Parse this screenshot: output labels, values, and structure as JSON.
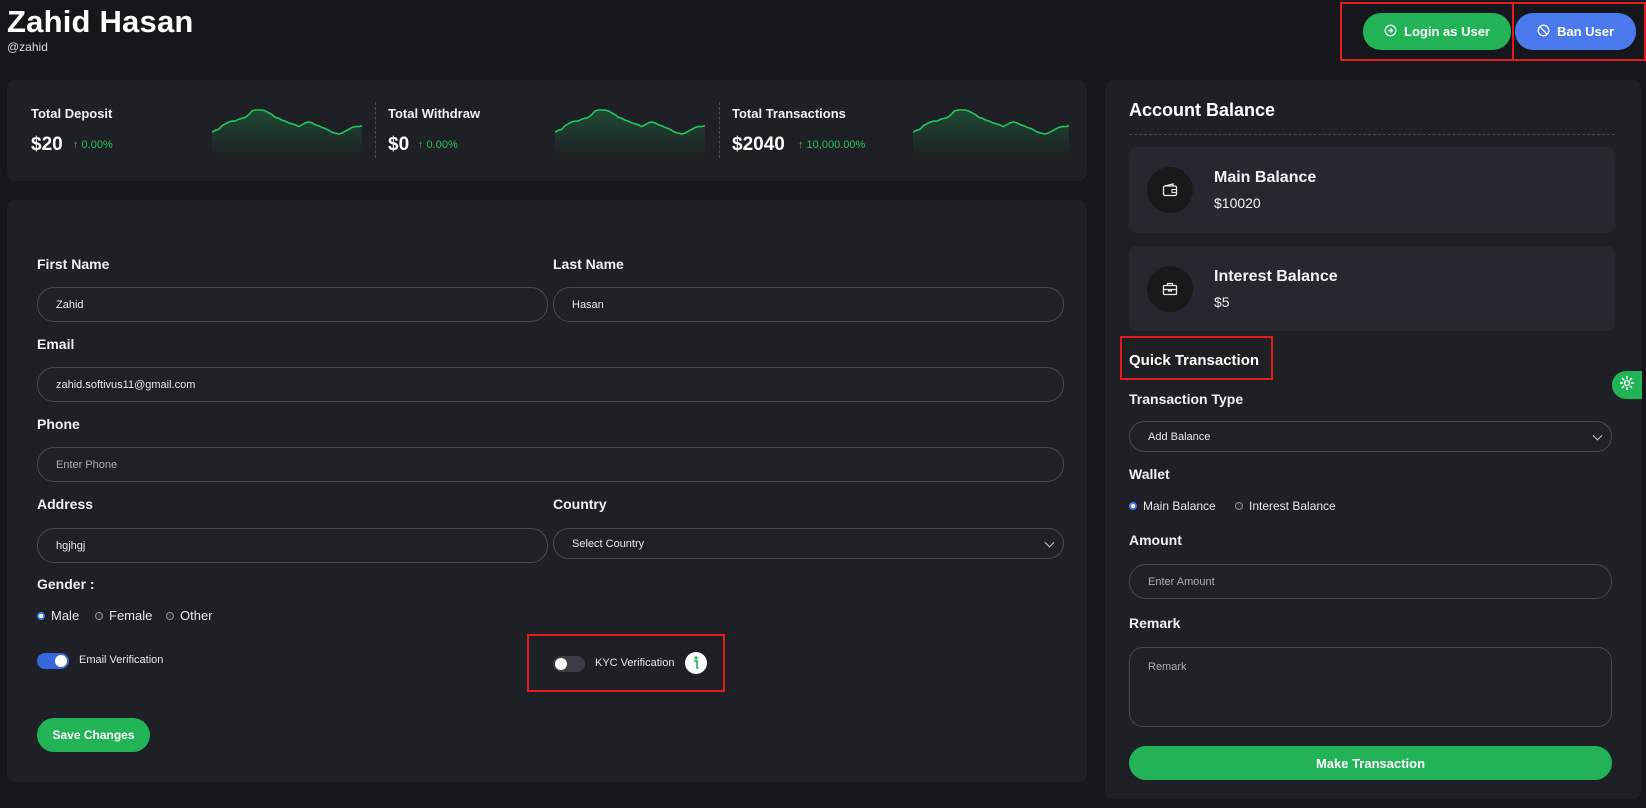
{
  "header": {
    "name": "Zahid Hasan",
    "username": "@zahid",
    "login_as_user": "Login as User",
    "ban_user": "Ban User"
  },
  "stats": [
    {
      "label": "Total Deposit",
      "value": "$20",
      "change": "↑ 0.00%"
    },
    {
      "label": "Total Withdraw",
      "value": "$0",
      "change": "↑ 0.00%"
    },
    {
      "label": "Total Transactions",
      "value": "$2040",
      "change": "↑ 10,000.00%"
    }
  ],
  "sparkline": [
    10,
    12,
    13,
    17,
    19,
    21,
    22,
    22,
    24,
    25,
    26,
    29,
    33,
    34,
    34,
    34,
    33,
    31,
    29,
    26,
    25,
    23,
    22,
    20,
    19,
    18,
    16,
    18,
    20,
    21,
    20,
    18,
    17,
    15,
    14,
    12,
    10,
    9,
    8,
    9,
    11,
    13,
    15,
    16,
    16,
    17
  ],
  "form": {
    "first_name_label": "First Name",
    "first_name_value": "Zahid",
    "last_name_label": "Last Name",
    "last_name_value": "Hasan",
    "email_label": "Email",
    "email_value": "zahid.softivus11@gmail.com",
    "phone_label": "Phone",
    "phone_placeholder": "Enter Phone",
    "address_label": "Address",
    "address_value": "hgjhgj",
    "country_label": "Country",
    "country_value": "Select Country",
    "gender_label": "Gender :",
    "gender_options": [
      "Male",
      "Female",
      "Other"
    ],
    "email_verification": "Email Verification",
    "kyc_verification": "KYC Verification",
    "save": "Save Changes"
  },
  "balance": {
    "title": "Account Balance",
    "main_label": "Main Balance",
    "main_value": "$10020",
    "interest_label": "Interest Balance",
    "interest_value": "$5"
  },
  "quick": {
    "title": "Quick Transaction",
    "type_label": "Transaction Type",
    "type_value": "Add Balance",
    "wallet_label": "Wallet",
    "wallet_options": [
      "Main Balance",
      "Interest Balance"
    ],
    "amount_label": "Amount",
    "amount_placeholder": "Enter Amount",
    "remark_label": "Remark",
    "remark_placeholder": "Remark",
    "submit": "Make Transaction"
  },
  "colors": {
    "accent_green": "#22b357",
    "accent_blue": "#4a79ee",
    "highlight_red": "#e01e1e"
  }
}
